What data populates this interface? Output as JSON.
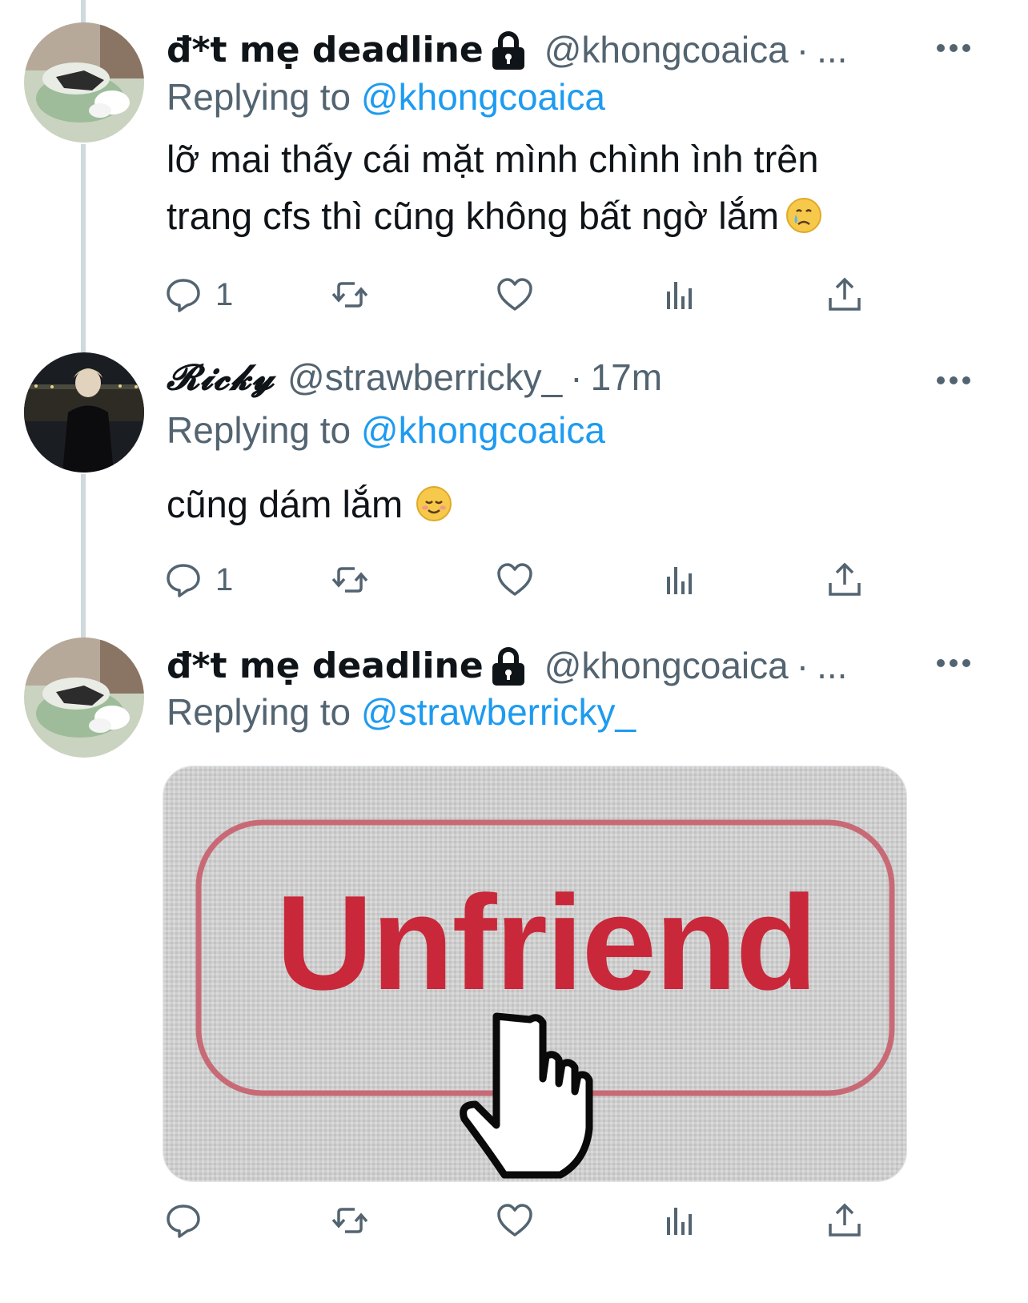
{
  "tweets": [
    {
      "display_name": "đ*t mẹ deadline",
      "protected": true,
      "handle": "@khongcoaica",
      "separator": "·",
      "time": "...",
      "replying_prefix": "Replying to",
      "replying_to": "@khongcoaica",
      "text_line1": "lỡ mai thấy cái mặt mình chình ình trên",
      "text_line2": "trang cfs thì cũng không bất ngờ lắm",
      "emoji": "crying-face",
      "reply_count": "1"
    },
    {
      "display_name": "𝓡𝓲𝓬𝓴𝔂",
      "protected": false,
      "handle": "@strawberricky_",
      "separator": "·",
      "time": "17m",
      "replying_prefix": "Replying to",
      "replying_to": "@khongcoaica",
      "text_line1": "cũng dám lắm",
      "emoji": "smiling-face",
      "reply_count": "1"
    },
    {
      "display_name": "đ*t mẹ deadline",
      "protected": true,
      "handle": "@khongcoaica",
      "separator": "·",
      "time": "...",
      "replying_prefix": "Replying to",
      "replying_to": "@strawberricky_",
      "media_text": "Unfriend",
      "reply_count": ""
    }
  ],
  "colors": {
    "accent": "#1d9bf0",
    "secondary_text": "#536471",
    "thread_line": "#cfd9de",
    "unfriend_red": "#c8283a"
  }
}
